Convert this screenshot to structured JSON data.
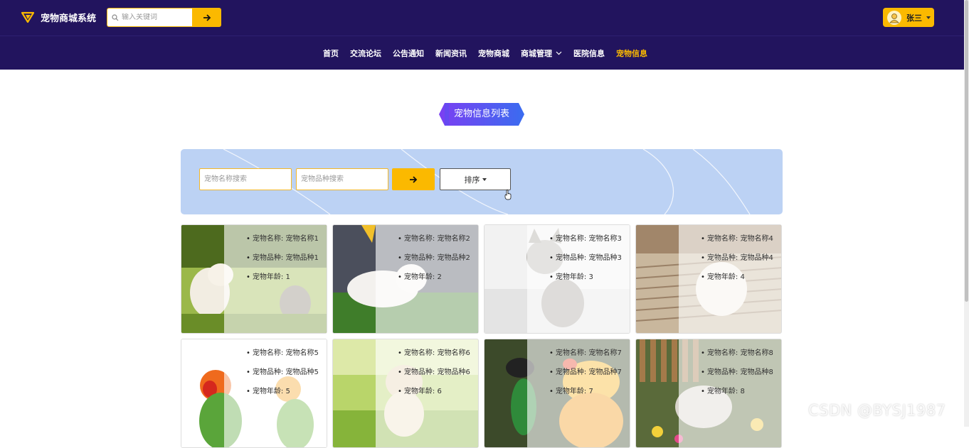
{
  "header": {
    "app_title": "宠物商城系统",
    "search_placeholder": "输入关键词",
    "user_name": "张三"
  },
  "nav": {
    "items": [
      {
        "label": "首页",
        "active": false
      },
      {
        "label": "交流论坛",
        "active": false
      },
      {
        "label": "公告通知",
        "active": false
      },
      {
        "label": "新闻资讯",
        "active": false
      },
      {
        "label": "宠物商城",
        "active": false
      },
      {
        "label": "商城管理",
        "active": false,
        "dropdown": true
      },
      {
        "label": "医院信息",
        "active": false
      },
      {
        "label": "宠物信息",
        "active": true
      }
    ]
  },
  "section_title": "宠物信息列表",
  "filters": {
    "name_placeholder": "宠物名称搜索",
    "breed_placeholder": "宠物品种搜索",
    "sort_label": "排序"
  },
  "pets": [
    {
      "name_label": "宠物名称: 宠物名称1",
      "breed_label": "宠物品种: 宠物品种1",
      "age_label": "宠物年龄: 1",
      "image": "kitten-grass"
    },
    {
      "name_label": "宠物名称: 宠物名称2",
      "breed_label": "宠物品种: 宠物品种2",
      "age_label": "宠物年龄: 2",
      "image": "white-kitten-lawn"
    },
    {
      "name_label": "宠物名称: 宠物名称3",
      "breed_label": "宠物品种: 宠物品种3",
      "age_label": "宠物年龄: 3",
      "image": "tabby-kitten"
    },
    {
      "name_label": "宠物名称: 宠物名称4",
      "breed_label": "宠物品种: 宠物品种4",
      "age_label": "宠物年龄: 4",
      "image": "white-kitten-bed"
    },
    {
      "name_label": "宠物名称: 宠物名称5",
      "breed_label": "宠物品种: 宠物品种5",
      "age_label": "宠物年龄: 5",
      "image": "lovebird"
    },
    {
      "name_label": "宠物名称: 宠物名称6",
      "breed_label": "宠物品种: 宠物品种6",
      "age_label": "宠物年龄: 6",
      "image": "kitten-meadow"
    },
    {
      "name_label": "宠物名称: 宠物名称7",
      "breed_label": "宠物品种: 宠物品种7",
      "age_label": "宠物年龄: 7",
      "image": "parrot"
    },
    {
      "name_label": "宠物名称: 宠物名称8",
      "breed_label": "宠物品种: 宠物品种8",
      "age_label": "宠物年龄: 8",
      "image": "rabbit"
    }
  ],
  "watermark": "CSDN @BYSJ1987",
  "colors": {
    "header_bg": "#22145e",
    "accent": "#fbb900",
    "panel_bg": "#bcd2f4",
    "title_gradient_start": "#7b3ff2",
    "title_gradient_end": "#3a6cf0"
  }
}
